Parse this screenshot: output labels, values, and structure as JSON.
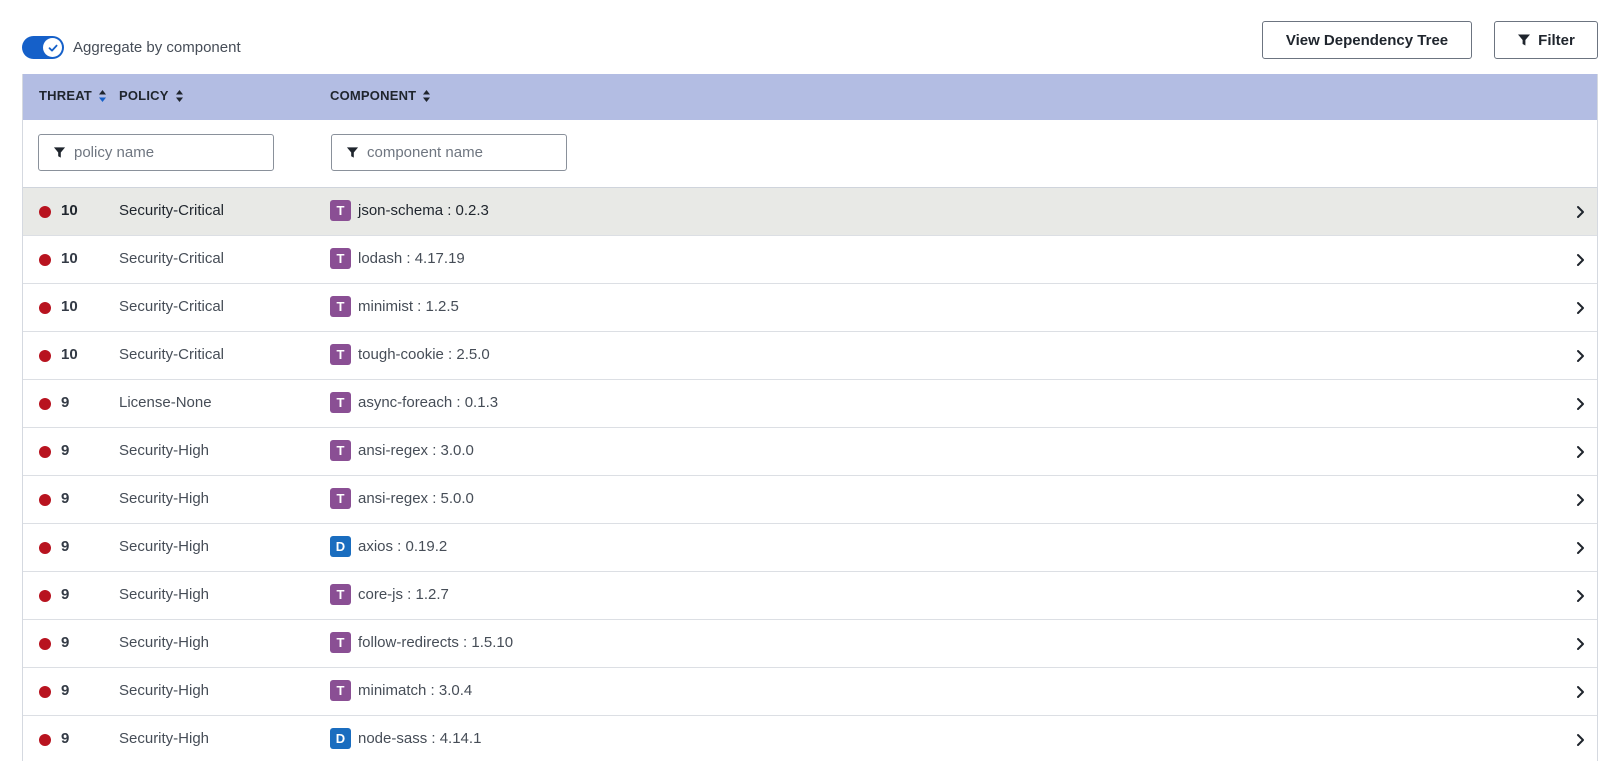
{
  "colors": {
    "header_bg": "#b3bde3",
    "toggle_on": "#1560c9",
    "threat_dot": "#b8131f",
    "badge_T": "#8a4f94",
    "badge_D": "#1a6dbf",
    "selected_row": "#e8e9e6"
  },
  "toolbar": {
    "aggregate_label": "Aggregate by component",
    "aggregate_on": true,
    "view_tree_label": "View Dependency Tree",
    "filter_label": "Filter"
  },
  "table": {
    "headers": {
      "threat": "THREAT",
      "policy": "POLICY",
      "component": "COMPONENT"
    },
    "filters": {
      "policy_placeholder": "policy name",
      "component_placeholder": "component name"
    },
    "rows": [
      {
        "threat": "10",
        "policy": "Security-Critical",
        "type": "T",
        "component": "json-schema : 0.2.3",
        "selected": true
      },
      {
        "threat": "10",
        "policy": "Security-Critical",
        "type": "T",
        "component": "lodash : 4.17.19"
      },
      {
        "threat": "10",
        "policy": "Security-Critical",
        "type": "T",
        "component": "minimist : 1.2.5"
      },
      {
        "threat": "10",
        "policy": "Security-Critical",
        "type": "T",
        "component": "tough-cookie : 2.5.0"
      },
      {
        "threat": "9",
        "policy": "License-None",
        "type": "T",
        "component": "async-foreach : 0.1.3"
      },
      {
        "threat": "9",
        "policy": "Security-High",
        "type": "T",
        "component": "ansi-regex : 3.0.0"
      },
      {
        "threat": "9",
        "policy": "Security-High",
        "type": "T",
        "component": "ansi-regex : 5.0.0"
      },
      {
        "threat": "9",
        "policy": "Security-High",
        "type": "D",
        "component": "axios : 0.19.2"
      },
      {
        "threat": "9",
        "policy": "Security-High",
        "type": "T",
        "component": "core-js : 1.2.7"
      },
      {
        "threat": "9",
        "policy": "Security-High",
        "type": "T",
        "component": "follow-redirects : 1.5.10"
      },
      {
        "threat": "9",
        "policy": "Security-High",
        "type": "T",
        "component": "minimatch : 3.0.4"
      },
      {
        "threat": "9",
        "policy": "Security-High",
        "type": "D",
        "component": "node-sass : 4.14.1"
      }
    ]
  }
}
